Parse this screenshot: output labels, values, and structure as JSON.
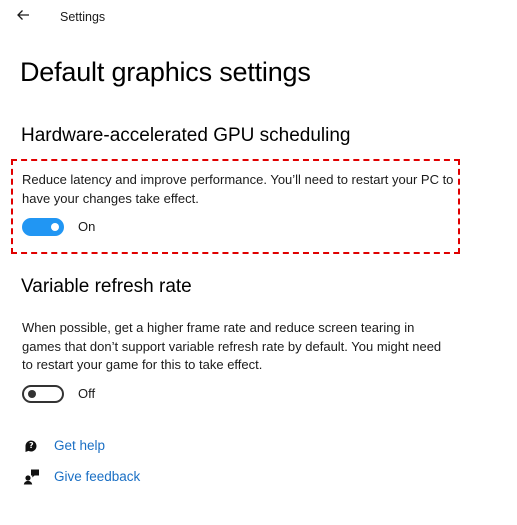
{
  "window": {
    "title": "Settings"
  },
  "page": {
    "title": "Default graphics settings"
  },
  "gpu_scheduling": {
    "title": "Hardware-accelerated GPU scheduling",
    "description": "Reduce latency and improve performance. You’ll need to restart your PC to have your changes take effect.",
    "state_label": "On",
    "enabled": true
  },
  "variable_refresh": {
    "title": "Variable refresh rate",
    "description": "When possible, get a higher frame rate and reduce screen tearing in games that don’t support variable refresh rate by default. You might need to restart your game for this to take effect.",
    "state_label": "Off",
    "enabled": false
  },
  "links": {
    "help": {
      "label": "Get help",
      "icon": "help-chat-icon"
    },
    "feedback": {
      "label": "Give feedback",
      "icon": "feedback-icon"
    }
  },
  "colors": {
    "toggle_on": "#2196f3",
    "link": "#1a6fc4",
    "highlight": "#e00000"
  }
}
